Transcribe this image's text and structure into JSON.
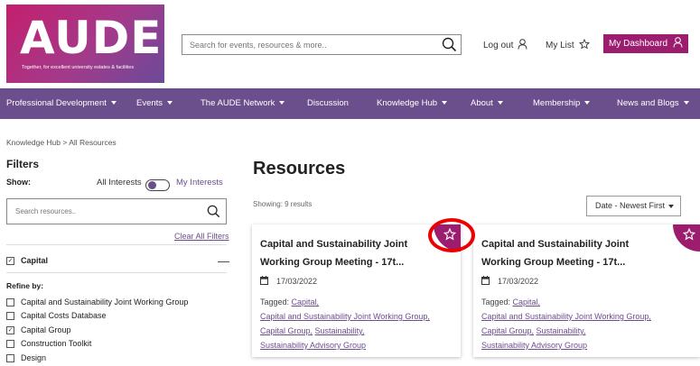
{
  "header": {
    "logo_text": "AUDE",
    "logo_tagline": "Together, for excellent university estates & facilities",
    "search_placeholder": "Search for events, resources & more..",
    "logout_label": "Log out",
    "mylist_label": "My List",
    "dashboard_label": "My Dashboard"
  },
  "nav": {
    "items": [
      {
        "label": "Professional Development",
        "dropdown": true
      },
      {
        "label": "Events",
        "dropdown": true
      },
      {
        "label": "The AUDE Network",
        "dropdown": true
      },
      {
        "label": "Discussion",
        "dropdown": false
      },
      {
        "label": "Knowledge Hub",
        "dropdown": true
      },
      {
        "label": "About",
        "dropdown": true
      },
      {
        "label": "Membership",
        "dropdown": true
      },
      {
        "label": "News and Blogs",
        "dropdown": true
      }
    ]
  },
  "sidebar": {
    "breadcrumb": "Knowledge Hub > All Resources",
    "filters_title": "Filters",
    "show_label": "Show:",
    "all_interests": "All Interests",
    "my_interests": "My Interests",
    "search_placeholder": "Search resources..",
    "clear_all": "Clear All Filters",
    "category": {
      "label": "Capital",
      "checked": true
    },
    "refine_label": "Refine by:",
    "refine_items": [
      {
        "label": "Capital and Sustainability Joint Working Group",
        "checked": false
      },
      {
        "label": "Capital Costs Database",
        "checked": false
      },
      {
        "label": "Capital Group",
        "checked": true
      },
      {
        "label": "Construction Toolkit",
        "checked": false
      },
      {
        "label": "Design",
        "checked": false
      }
    ]
  },
  "main": {
    "title": "Resources",
    "showing": "Showing: 9 results",
    "sort_value": "Date - Newest First",
    "cards": [
      {
        "title": "Capital and Sustainability Joint Working Group Meeting - 17t...",
        "date": "17/03/2022",
        "tagged_label": "Tagged:",
        "tags": [
          "Capital,",
          "Capital and Sustainability Joint Working Group,",
          "Capital Group,",
          "Sustainability,",
          "Sustainability Advisory Group"
        ]
      },
      {
        "title": "Capital and Sustainability Joint Working Group Meeting - 17t...",
        "date": "17/03/2022",
        "tagged_label": "Tagged:",
        "tags": [
          "Capital,",
          "Capital and Sustainability Joint Working Group,",
          "Capital Group,",
          "Sustainability,",
          "Sustainability Advisory Group"
        ]
      }
    ]
  },
  "colors": {
    "brand_purple": "#6b4e8c",
    "brand_magenta": "#9c1d6e",
    "highlight_red": "#e00000"
  },
  "icons": [
    "search-icon",
    "user-icon",
    "star-icon",
    "calendar-icon",
    "chevron-down-icon",
    "minus-icon",
    "check-icon"
  ]
}
